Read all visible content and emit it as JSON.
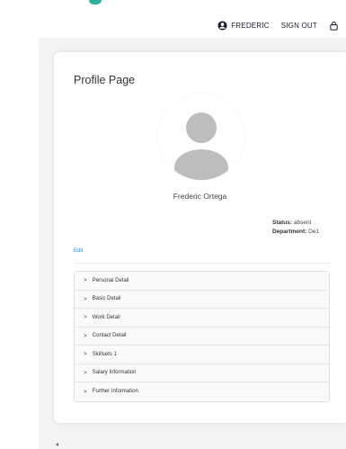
{
  "header": {
    "username": "FREDERIC",
    "signout_label": "SIGN OUT",
    "icons": {
      "user": "account-circle-icon",
      "lock": "lock-icon"
    }
  },
  "profile": {
    "page_title": "Profile Page",
    "full_name": "Frederic Ortega",
    "status_label": "Status:",
    "status_value": "absent",
    "department_label": "Department:",
    "department_value": "De1",
    "edit_label": "Edit"
  },
  "accordion": {
    "items": [
      {
        "label": "Personal Detail"
      },
      {
        "label": "Basic Detail"
      },
      {
        "label": "Work Detail"
      },
      {
        "label": "Contact Detail"
      },
      {
        "label": "Skillsets 1"
      },
      {
        "label": "Salary Information"
      },
      {
        "label": "Further Information"
      }
    ]
  },
  "colors": {
    "accent_link": "#1e88e5",
    "logo_teal": "#2ab3a0",
    "avatar_gray": "#bdbdbd"
  }
}
